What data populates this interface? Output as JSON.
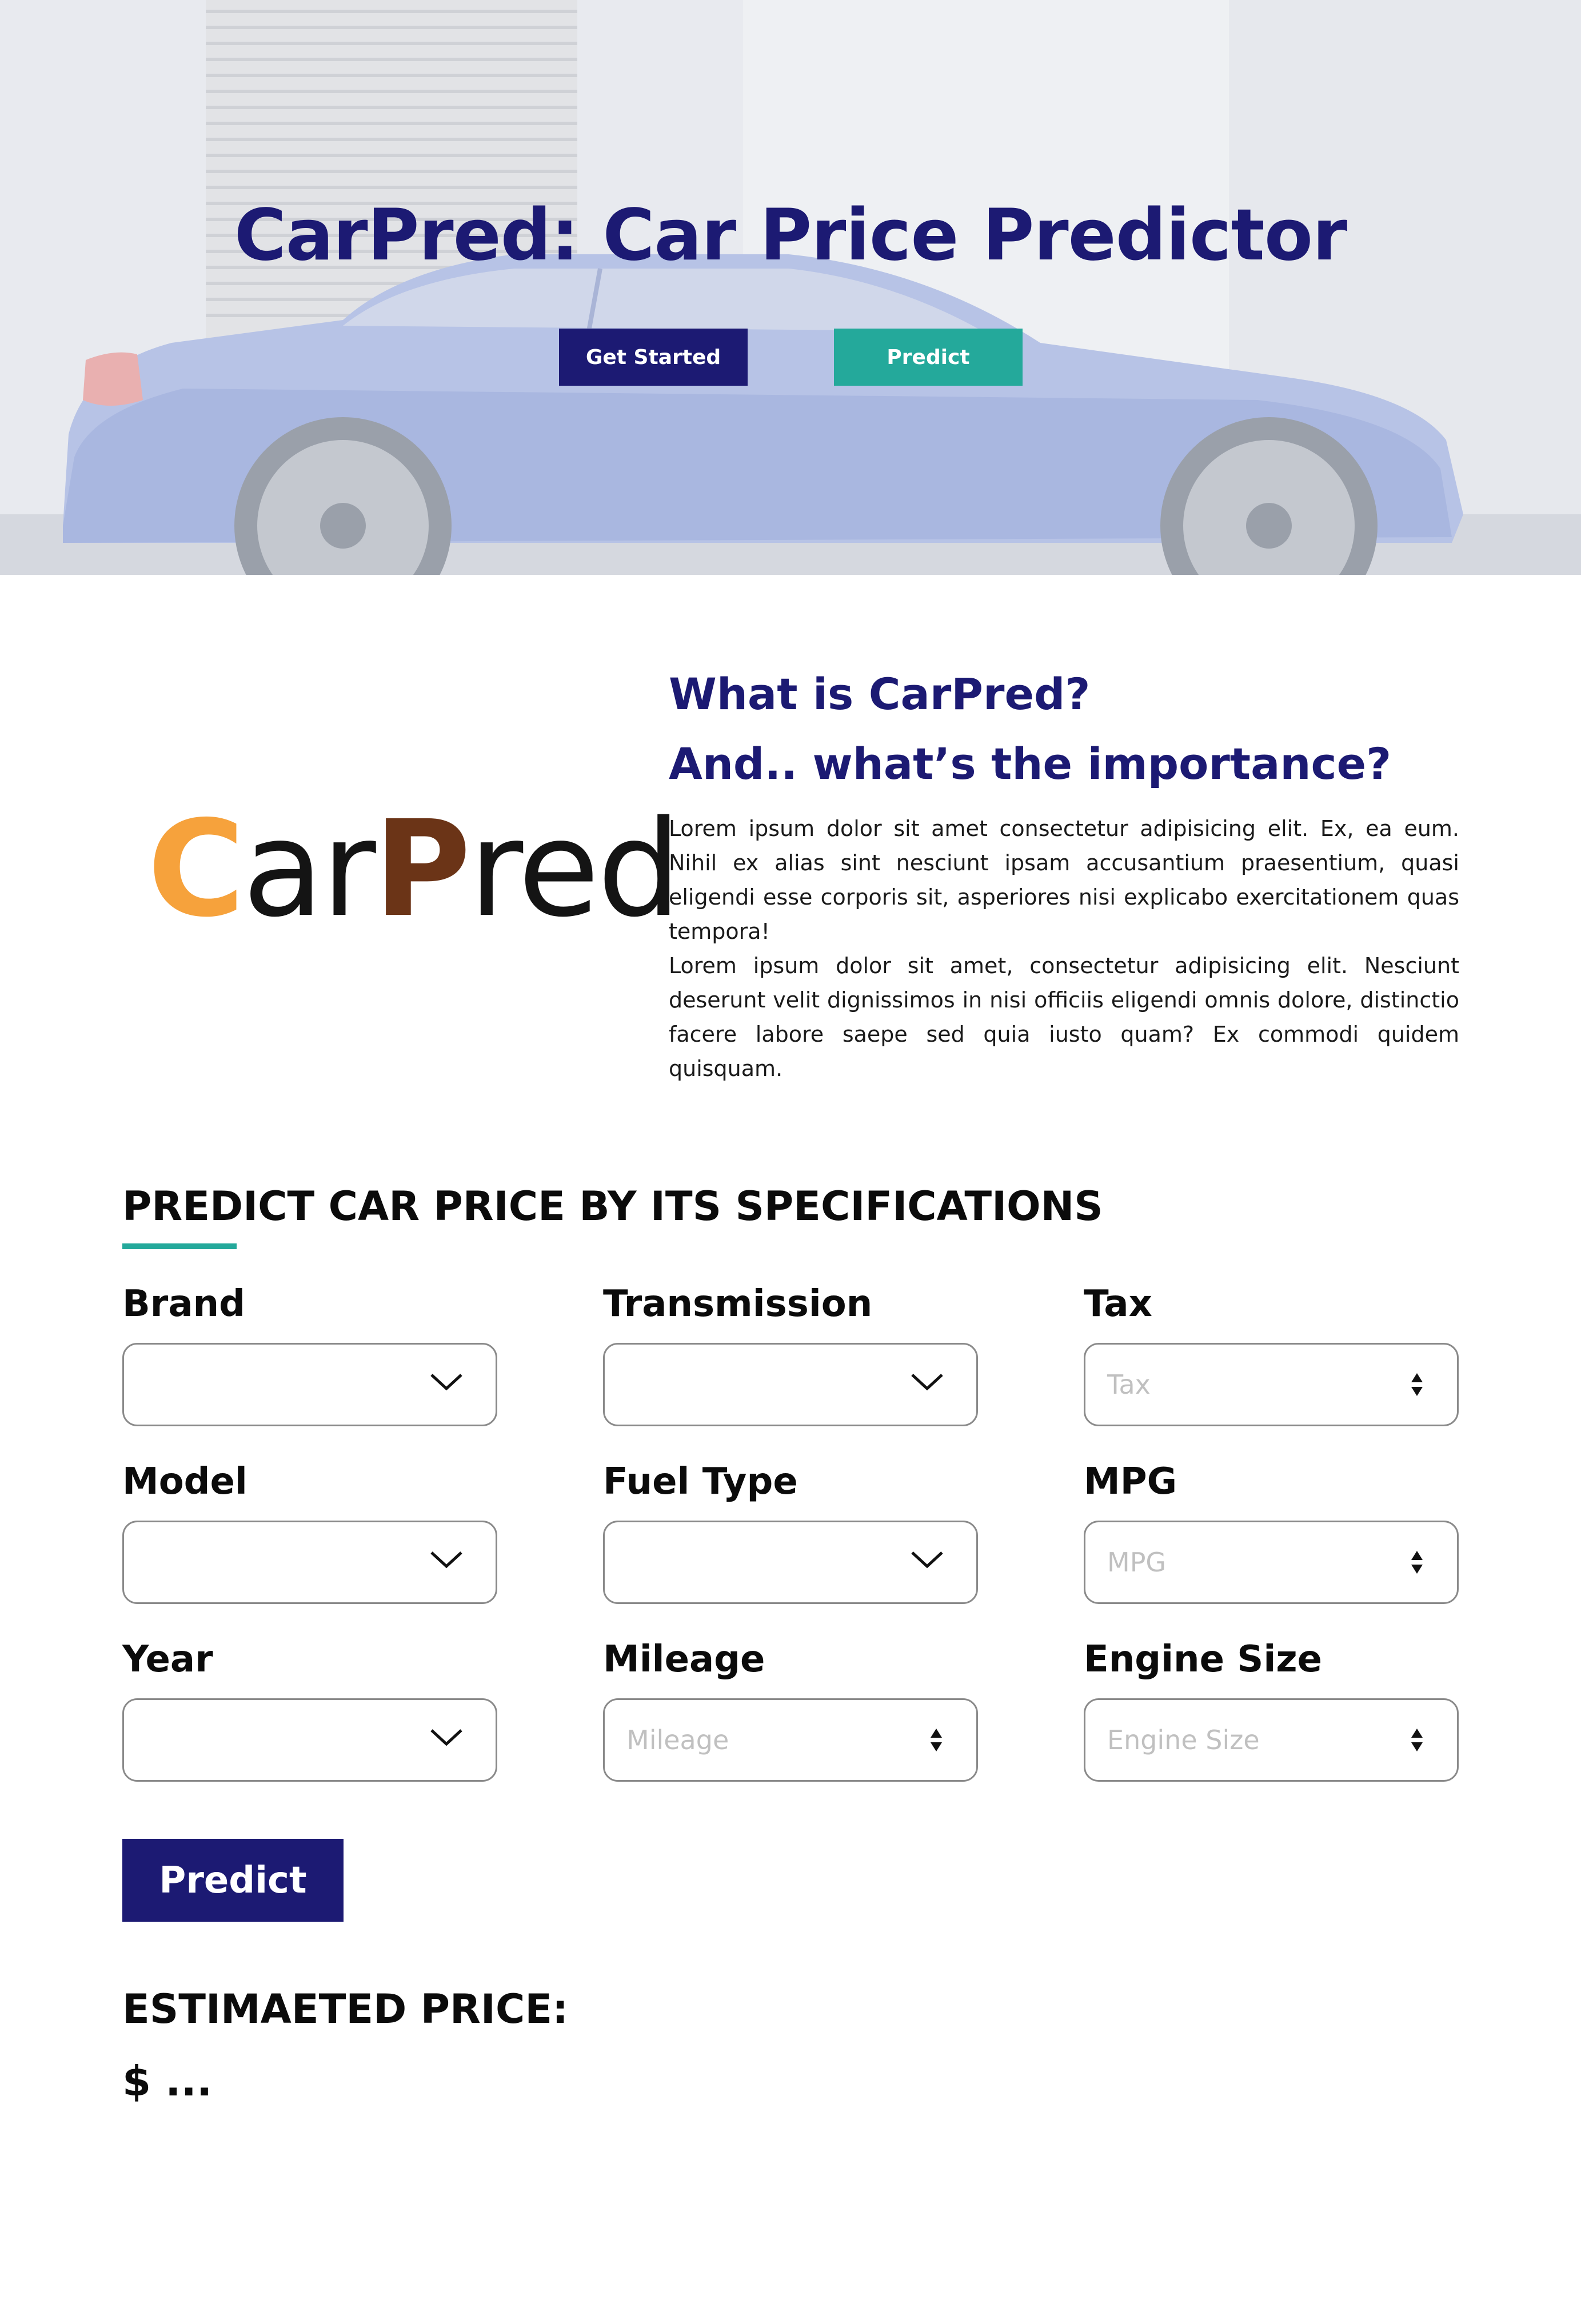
{
  "hero": {
    "title": "CarPred: Car Price Predictor",
    "get_started_label": "Get Started",
    "predict_label": "Predict"
  },
  "about": {
    "logo": {
      "c": "C",
      "ar": "ar",
      "p": "P",
      "red": "red"
    },
    "heading_line1": "What is CarPred?",
    "heading_line2": "And.. what’s the importance?",
    "paragraph1": "Lorem ipsum dolor sit amet consectetur adipisicing elit. Ex, ea eum. Nihil ex alias sint nesciunt ipsam accusantium praesentium, quasi eligendi esse corporis sit, asperiores nisi explicabo exercitationem quas tempora!",
    "paragraph2": "Lorem ipsum dolor sit amet, consectetur adipisicing elit. Nesciunt deserunt velit dignissimos in nisi officiis eligendi omnis dolore, distinctio facere labore saepe sed quia iusto quam? Ex commodi quidem quisquam."
  },
  "form": {
    "title": "PREDICT CAR PRICE BY ITS SPECIFICATIONS",
    "fields": {
      "brand": {
        "label": "Brand",
        "value": ""
      },
      "model": {
        "label": "Model",
        "value": ""
      },
      "year": {
        "label": "Year",
        "value": ""
      },
      "transmission": {
        "label": "Transmission",
        "value": ""
      },
      "fuel_type": {
        "label": "Fuel Type",
        "value": ""
      },
      "mileage": {
        "label": "Mileage",
        "placeholder": "Mileage"
      },
      "tax": {
        "label": "Tax",
        "placeholder": "Tax"
      },
      "mpg": {
        "label": "MPG",
        "placeholder": "MPG"
      },
      "engine_size": {
        "label": "Engine Size",
        "placeholder": "Engine Size"
      }
    },
    "predict_label": "Predict"
  },
  "result": {
    "label": "ESTIMAETED PRICE:",
    "value": "$ ..."
  },
  "colors": {
    "primary": "#1c1a73",
    "accent": "#24a99b",
    "logo_orange": "#f6a23c",
    "logo_brown": "#6b3417"
  }
}
